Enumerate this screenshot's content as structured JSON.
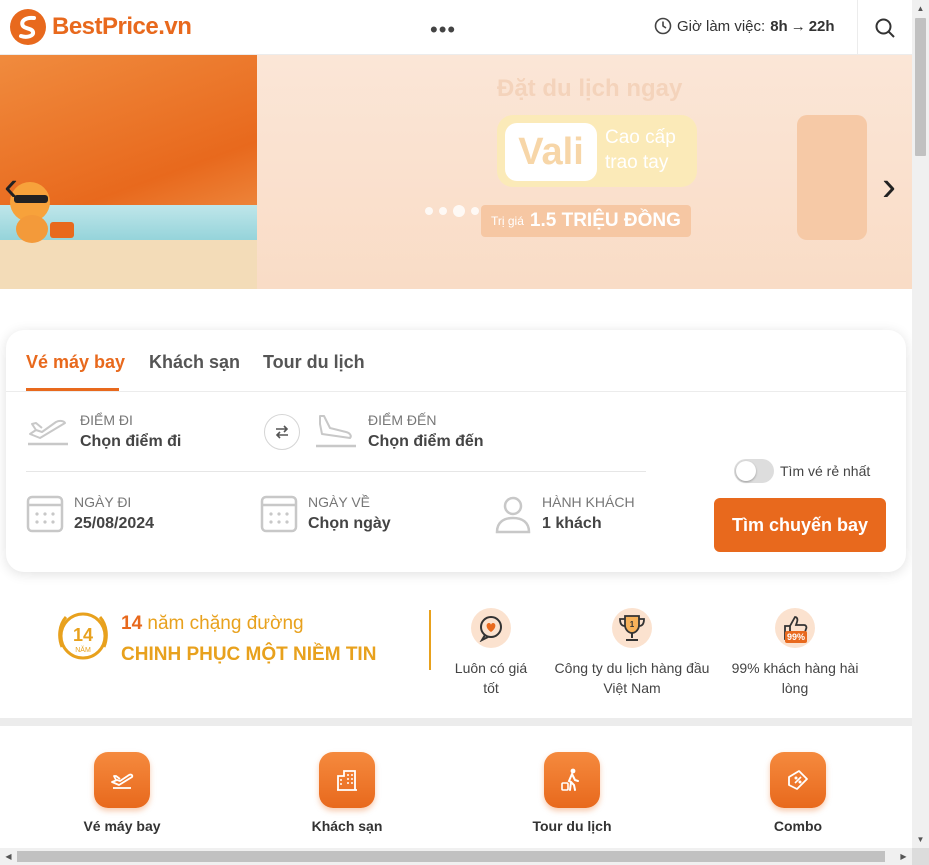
{
  "header": {
    "logo_text": "BestPrice.vn",
    "more_label": "•••",
    "hours_label": "Giờ làm việc:",
    "hours_from": "8h",
    "hours_arrow": "→",
    "hours_to": "22h",
    "search_icon": "search-icon"
  },
  "banner": {
    "headline": "Đặt du lịch ngay",
    "vali_word": "Vali",
    "vali_sub1": "Cao cấp",
    "vali_sub2": "trao tay",
    "price_prefix": "Trị giá",
    "price_value": "1.5 TRIỆU ĐỒNG",
    "prev_arrow": "‹",
    "next_arrow": "›"
  },
  "search": {
    "tabs": [
      "Vé máy bay",
      "Khách sạn",
      "Tour du lịch"
    ],
    "active_tab": 0,
    "from_label": "Điểm đi",
    "from_value": "Chọn điểm đi",
    "to_label": "Điểm đến",
    "to_value": "Chọn điểm đến",
    "depart_label": "Ngày đi",
    "depart_value": "25/08/2024",
    "return_label": "Ngày về",
    "return_value": "Chọn ngày",
    "pax_label": "Hành khách",
    "pax_value": "1 khách",
    "cheapest_label": "Tìm vé rẻ nhất",
    "cheapest_on": false,
    "submit_label": "Tìm chuyến bay"
  },
  "trust": {
    "badge_number": "14",
    "badge_unit": "NĂM",
    "line1_number": "14",
    "line1_text": "năm chặng đường",
    "line2": "CHINH PHỤC MỘT NIỀM TIN",
    "features": [
      {
        "line1": "Luôn có giá",
        "line2": "tốt",
        "icon": "price-tag-icon"
      },
      {
        "line1": "Công ty du lịch hàng đầu",
        "line2": "Việt Nam",
        "icon": "trophy-icon"
      },
      {
        "line1": "99% khách hàng hài",
        "line2": "lòng",
        "icon": "thumbs-up-icon"
      }
    ],
    "satisfaction_badge": "99%"
  },
  "services": [
    {
      "label": "Vé máy bay",
      "icon": "plane-icon"
    },
    {
      "label": "Khách sạn",
      "icon": "hotel-icon"
    },
    {
      "label": "Tour du lịch",
      "icon": "traveler-icon"
    },
    {
      "label": "Combo",
      "icon": "combo-ticket-icon"
    }
  ],
  "colors": {
    "brand": "#e8691d",
    "gold": "#e8a11d"
  }
}
